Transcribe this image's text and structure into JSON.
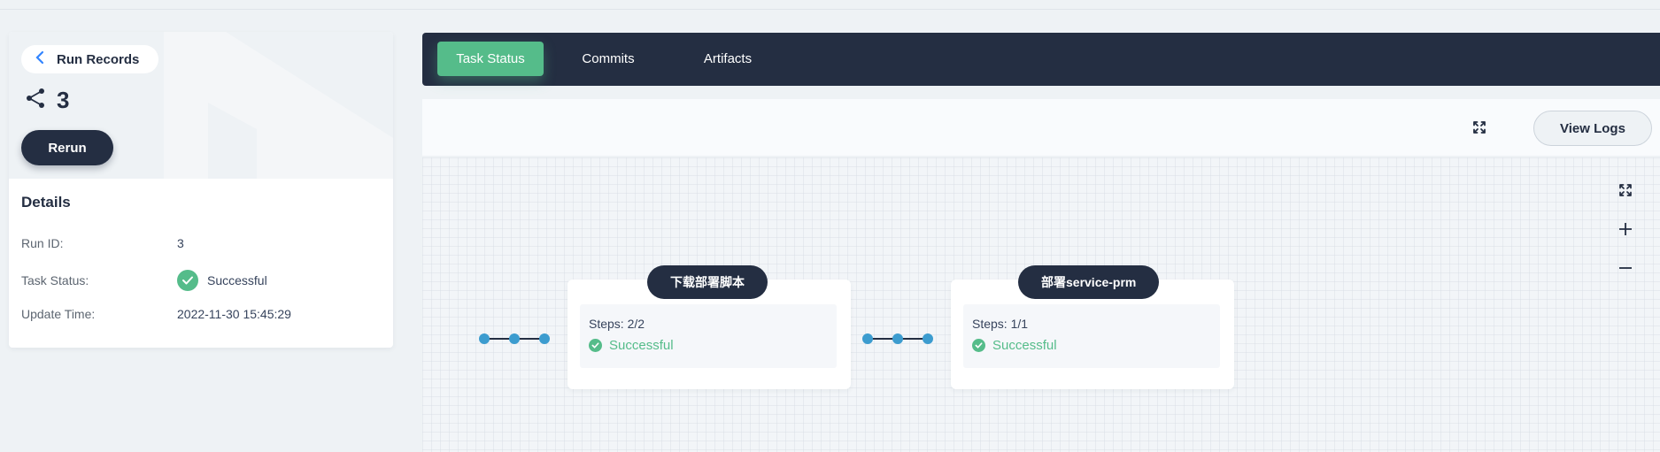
{
  "header": {
    "back_label": "Run Records",
    "run_number": "3",
    "rerun_label": "Rerun"
  },
  "details": {
    "title": "Details",
    "rows": [
      {
        "key": "Run ID:",
        "value": "3"
      },
      {
        "key": "Task Status:",
        "value": "Successful"
      },
      {
        "key": "Update Time:",
        "value": "2022-11-30 15:45:29"
      }
    ]
  },
  "tabs": [
    {
      "label": "Task Status",
      "active": true
    },
    {
      "label": "Commits",
      "active": false
    },
    {
      "label": "Artifacts",
      "active": false
    }
  ],
  "toolbar": {
    "view_logs_label": "View Logs"
  },
  "stages": [
    {
      "title": "下载部署脚本",
      "steps": "Steps: 2/2",
      "status": "Successful"
    },
    {
      "title": "部署service-prm",
      "steps": "Steps: 1/1",
      "status": "Successful"
    }
  ],
  "icons": {
    "back": "chevron-left-icon",
    "pipeline": "pipeline-icon",
    "status": "check-circle-icon",
    "expand": "expand-icon",
    "zoom_fit": "fit-screen-icon",
    "zoom_in": "plus-icon",
    "zoom_out": "minus-icon"
  },
  "colors": {
    "primary_dark": "#242e42",
    "success": "#55bc8a",
    "node_blue": "#3c9ccf",
    "background": "#eef2f5"
  }
}
